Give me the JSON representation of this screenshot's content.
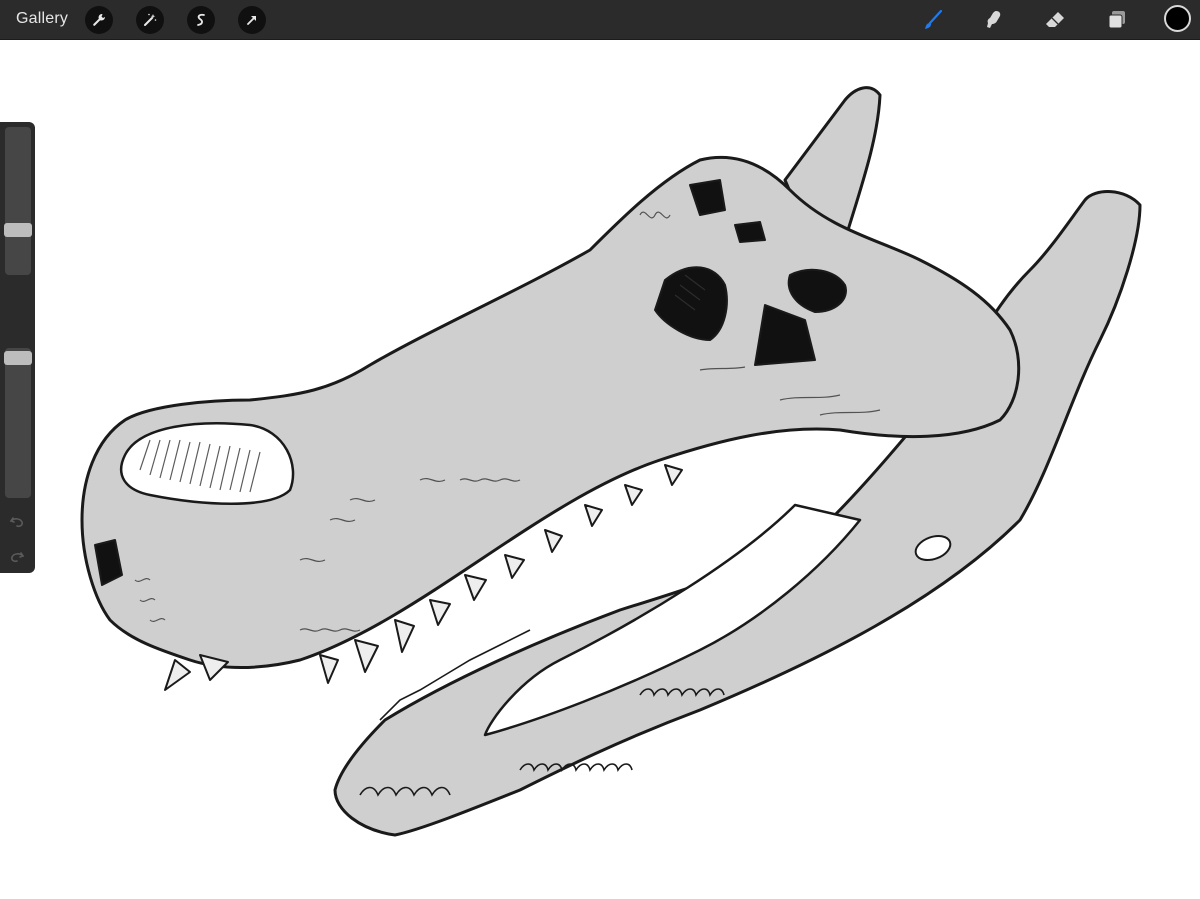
{
  "app": {
    "gallery_label": "Gallery"
  },
  "toolbar_left": [
    {
      "name": "actions-wrench-icon"
    },
    {
      "name": "adjustments-wand-icon"
    },
    {
      "name": "selection-icon"
    },
    {
      "name": "transform-arrow-icon"
    }
  ],
  "toolbar_right": [
    {
      "name": "brush-icon",
      "active": true,
      "color": "#1e7bf2"
    },
    {
      "name": "smudge-icon"
    },
    {
      "name": "eraser-icon"
    },
    {
      "name": "layers-icon"
    }
  ],
  "current_color": "#000000",
  "sidebar": {
    "brush_size_level": 0.35,
    "opacity_level": 0.95,
    "undo_icon": "undo-icon",
    "redo_icon": "redo-icon"
  },
  "canvas": {
    "drawing_subject": "crocodile-skull-sketch",
    "fill_color": "#cfcfcf",
    "stroke_color": "#1a1a1a"
  }
}
